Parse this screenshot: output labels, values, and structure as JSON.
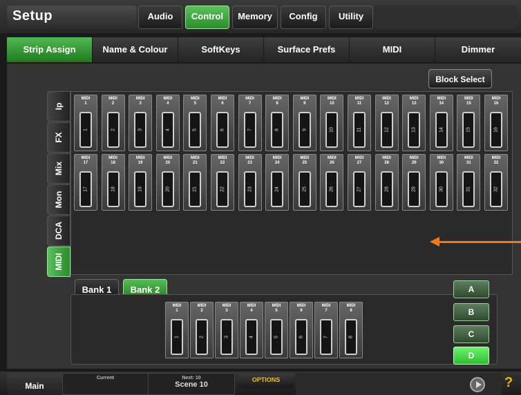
{
  "header": {
    "title": "Setup",
    "tabs": [
      {
        "label": "Audio",
        "active": false
      },
      {
        "label": "Control",
        "active": true
      },
      {
        "label": "Memory",
        "active": false
      },
      {
        "label": "Config",
        "active": false
      },
      {
        "label": "Utility",
        "active": false
      }
    ]
  },
  "subtabs": [
    {
      "label": "Strip Assign",
      "active": true
    },
    {
      "label": "Name & Colour",
      "active": false
    },
    {
      "label": "SoftKeys",
      "active": false
    },
    {
      "label": "Surface Prefs",
      "active": false
    },
    {
      "label": "MIDI",
      "active": false
    },
    {
      "label": "Dimmer",
      "active": false
    }
  ],
  "block_select_label": "Block Select",
  "source_tabs": [
    {
      "label": "Ip",
      "active": false
    },
    {
      "label": "FX",
      "active": false
    },
    {
      "label": "Mix",
      "active": false
    },
    {
      "label": "Mon",
      "active": false
    },
    {
      "label": "DCA",
      "active": false
    },
    {
      "label": "MIDI",
      "active": true
    }
  ],
  "strip_prefix": "MIDI",
  "source_strips_row1": [
    "1",
    "2",
    "3",
    "4",
    "5",
    "6",
    "7",
    "8",
    "9",
    "10",
    "11",
    "12",
    "13",
    "14",
    "15",
    "16"
  ],
  "source_strips_row2": [
    "17",
    "18",
    "19",
    "20",
    "21",
    "22",
    "23",
    "24",
    "25",
    "26",
    "27",
    "28",
    "29",
    "30",
    "31",
    "32"
  ],
  "banks": [
    {
      "label": "Bank 1",
      "active": false
    },
    {
      "label": "Bank 2",
      "active": true
    }
  ],
  "bank_strips": [
    "1",
    "2",
    "3",
    "4",
    "5",
    "6",
    "7",
    "8"
  ],
  "layers": [
    {
      "label": "A",
      "active": false
    },
    {
      "label": "B",
      "active": false
    },
    {
      "label": "C",
      "active": false
    },
    {
      "label": "D",
      "active": true
    }
  ],
  "footer": {
    "main_label": "Main",
    "current_label": "Current",
    "next_label": "Next: 10",
    "scene_label": "Scene 10",
    "options_label": "OPTIONS",
    "help_label": "?"
  },
  "colors": {
    "accent_green": "#3fa83f",
    "arrow": "#f07a1a",
    "options_text": "#f0c020"
  }
}
